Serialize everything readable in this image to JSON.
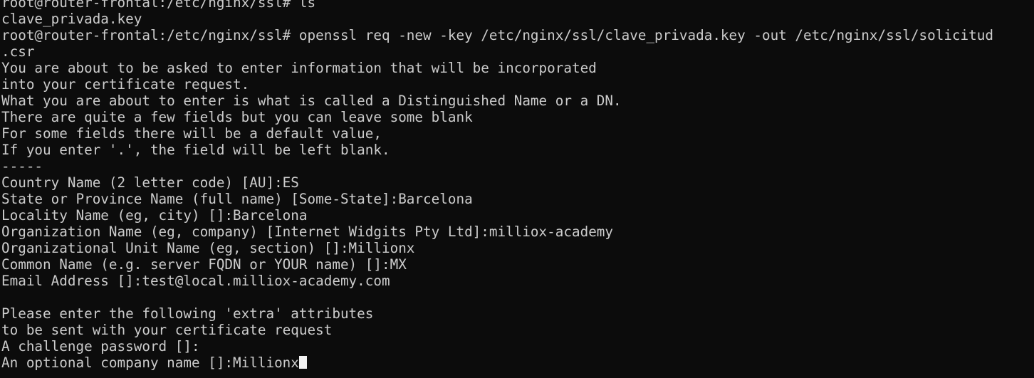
{
  "terminal": {
    "lines": [
      "root@router-frontal:/etc/nginx/ssl# ls",
      "clave_privada.key",
      "root@router-frontal:/etc/nginx/ssl# openssl req -new -key /etc/nginx/ssl/clave_privada.key -out /etc/nginx/ssl/solicitud",
      ".csr",
      "You are about to be asked to enter information that will be incorporated",
      "into your certificate request.",
      "What you are about to enter is what is called a Distinguished Name or a DN.",
      "There are quite a few fields but you can leave some blank",
      "For some fields there will be a default value,",
      "If you enter '.', the field will be left blank.",
      "-----",
      "Country Name (2 letter code) [AU]:ES",
      "State or Province Name (full name) [Some-State]:Barcelona",
      "Locality Name (eg, city) []:Barcelona",
      "Organization Name (eg, company) [Internet Widgits Pty Ltd]:milliox-academy",
      "Organizational Unit Name (eg, section) []:Millionx",
      "Common Name (e.g. server FQDN or YOUR name) []:MX",
      "Email Address []:test@local.milliox-academy.com",
      "",
      "Please enter the following 'extra' attributes",
      "to be sent with your certificate request",
      "A challenge password []:",
      "An optional company name []:Millionx"
    ]
  }
}
